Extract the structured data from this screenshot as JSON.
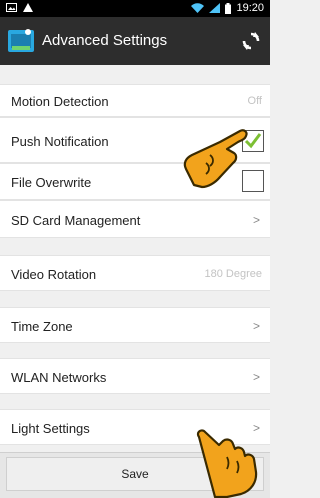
{
  "status_bar": {
    "time": "19:20"
  },
  "header": {
    "title": "Advanced Settings"
  },
  "rows": [
    {
      "label": "Motion Detection",
      "value": "Off"
    },
    {
      "label": "Push Notification"
    },
    {
      "label": "File Overwrite"
    },
    {
      "label": "SD Card Management",
      "chevron": ">"
    },
    {
      "label": "Video Rotation",
      "value": "180 Degree"
    },
    {
      "label": "Time Zone",
      "chevron": ">"
    },
    {
      "label": "WLAN Networks",
      "chevron": ">"
    },
    {
      "label": "Light Settings",
      "chevron": ">"
    }
  ],
  "push_notification_checked": true,
  "file_overwrite_checked": false,
  "footer": {
    "save_label": "Save"
  },
  "colors": {
    "action_bar": "#2d2d2d",
    "check_green": "#7cbf33",
    "hand_orange": "#f2a31c"
  },
  "icons": [
    "image-icon",
    "warning-icon",
    "wifi-icon",
    "signal-icon",
    "battery-icon",
    "app-icon",
    "refresh-icon",
    "check-icon",
    "pointing-hand-icon"
  ]
}
